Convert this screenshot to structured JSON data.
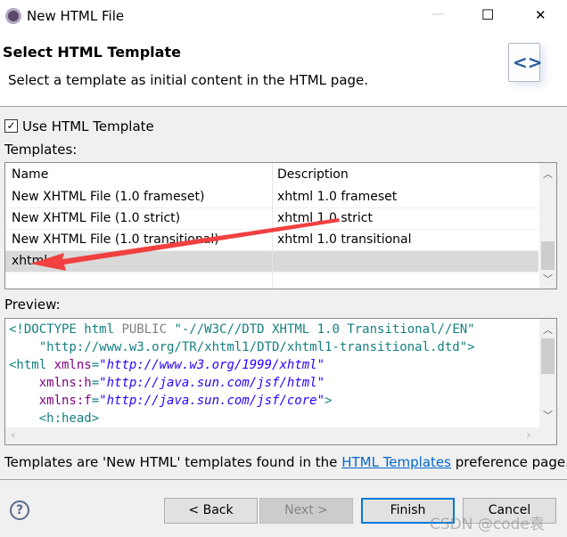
{
  "window": {
    "title": "New HTML File",
    "minimize": "—",
    "maximize": "☐",
    "close": "✕"
  },
  "banner": {
    "title": "Select HTML Template",
    "description": "Select a template as initial content in the HTML page."
  },
  "use_template": {
    "label": "Use HTML Template",
    "checked": true
  },
  "templates": {
    "label": "Templates:",
    "columns": [
      "Name",
      "Description"
    ],
    "rows": [
      {
        "name": "New XHTML File (1.0 frameset)",
        "description": "xhtml 1.0 frameset"
      },
      {
        "name": "New XHTML File (1.0 strict)",
        "description": "xhtml 1.0 strict"
      },
      {
        "name": "New XHTML File (1.0 transitional)",
        "description": "xhtml 1.0 transitional"
      },
      {
        "name": "xhtml",
        "description": "",
        "selected": true
      }
    ]
  },
  "preview": {
    "label": "Preview:",
    "lines": [
      [
        [
          "tag",
          "<!DOCTYPE html "
        ],
        [
          "pub",
          "PUBLIC "
        ],
        [
          "dt",
          "\"-//W3C//DTD XHTML 1.0 Transitional//EN\""
        ]
      ],
      [
        [
          "dt",
          "    \"http://www.w3.org/TR/xhtml1/DTD/xhtml1-transitional.dtd\""
        ],
        [
          "tag",
          ">"
        ]
      ],
      [
        [
          "tag",
          "<html "
        ],
        [
          "attr",
          "xmlns"
        ],
        [
          "tag",
          "="
        ],
        [
          "val",
          "\"http://www.w3.org/1999/xhtml\""
        ]
      ],
      [
        [
          "attr",
          "    xmlns:h"
        ],
        [
          "tag",
          "="
        ],
        [
          "val",
          "\"http://java.sun.com/jsf/html\""
        ]
      ],
      [
        [
          "attr",
          "    xmlns:f"
        ],
        [
          "tag",
          "="
        ],
        [
          "val",
          "\"http://java.sun.com/jsf/core\""
        ],
        [
          "tag",
          ">"
        ]
      ],
      [
        [
          "tag",
          "    <h:head>"
        ]
      ]
    ]
  },
  "footer_note": {
    "before": "Templates are 'New HTML' templates found in the ",
    "link": "HTML Templates",
    "after": " preference page."
  },
  "buttons": {
    "help": "?",
    "back": "< Back",
    "next": "Next >",
    "finish": "Finish",
    "cancel": "Cancel"
  },
  "watermark": "CSDN @code袁",
  "annotation_color": "#f04040"
}
